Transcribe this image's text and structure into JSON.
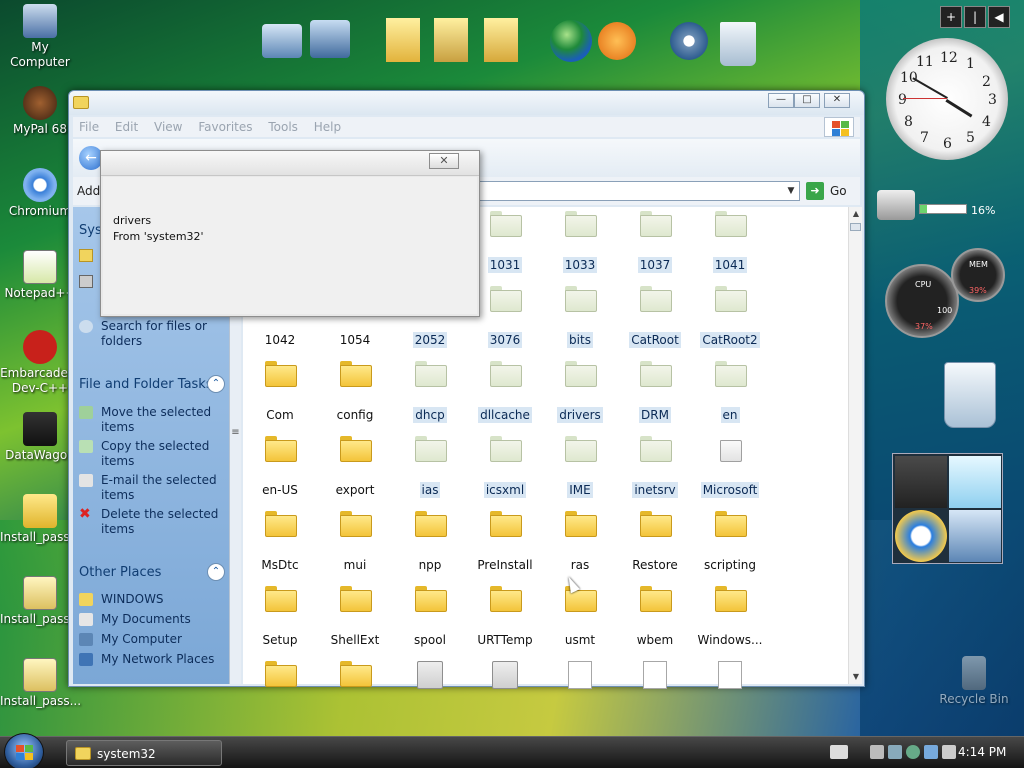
{
  "desktop": {
    "icons": [
      {
        "label": "My Computer"
      },
      {
        "label": "MyPal 68"
      },
      {
        "label": "Chromium"
      },
      {
        "label": "Notepad++"
      },
      {
        "label": "Embarcadero Dev-C++"
      },
      {
        "label": "DataWagon"
      },
      {
        "label": "Install_pass..."
      },
      {
        "label": "Install_pass..."
      },
      {
        "label": "Install_pass..."
      },
      {
        "label": "Recycle Bin"
      }
    ]
  },
  "dock": {
    "icons": [
      "computer-icon",
      "network-computer-icon",
      "folder-icon",
      "pictures-folder-icon",
      "music-folder-icon",
      "globe-icon",
      "media-player-icon",
      "settings-gear-icon",
      "recycle-bin-icon"
    ]
  },
  "window": {
    "menu": [
      "File",
      "Edit",
      "View",
      "Favorites",
      "Tools",
      "Help"
    ],
    "address_label": "Addr",
    "go_label": "Go",
    "pane": {
      "system_tasks_header": "Syst",
      "search_link": "Search for files or folders",
      "file_tasks_header": "File and Folder Tasks",
      "file_tasks": [
        "Move the selected items",
        "Copy the selected items",
        "E-mail the selected items",
        "Delete the selected items"
      ],
      "other_places_header": "Other Places",
      "other_places": [
        "WINDOWS",
        "My Documents",
        "My Computer",
        "My Network Places"
      ]
    },
    "items": [
      {
        "name": "1031",
        "kind": "ghost",
        "selected": true
      },
      {
        "name": "1033",
        "kind": "ghost",
        "selected": true
      },
      {
        "name": "1037",
        "kind": "ghost",
        "selected": true
      },
      {
        "name": "1041",
        "kind": "ghost",
        "selected": true
      },
      {
        "name": "1042",
        "kind": "folder",
        "selected": false
      },
      {
        "name": "1054",
        "kind": "folder",
        "selected": false
      },
      {
        "name": "2052",
        "kind": "ghost",
        "selected": true
      },
      {
        "name": "3076",
        "kind": "ghost",
        "selected": true
      },
      {
        "name": "bits",
        "kind": "ghost",
        "selected": true
      },
      {
        "name": "CatRoot",
        "kind": "ghost",
        "selected": true
      },
      {
        "name": "CatRoot2",
        "kind": "ghost",
        "selected": true
      },
      {
        "name": "Com",
        "kind": "folder",
        "selected": false
      },
      {
        "name": "config",
        "kind": "folder",
        "selected": false
      },
      {
        "name": "dhcp",
        "kind": "ghost",
        "selected": true
      },
      {
        "name": "dllcache",
        "kind": "ghost",
        "selected": true
      },
      {
        "name": "drivers",
        "kind": "ghost",
        "selected": true
      },
      {
        "name": "DRM",
        "kind": "ghost",
        "selected": true
      },
      {
        "name": "en",
        "kind": "ghost",
        "selected": true
      },
      {
        "name": "en-US",
        "kind": "folder",
        "selected": false
      },
      {
        "name": "export",
        "kind": "folder",
        "selected": false
      },
      {
        "name": "ias",
        "kind": "ghost",
        "selected": true
      },
      {
        "name": "icsxml",
        "kind": "ghost",
        "selected": true
      },
      {
        "name": "IME",
        "kind": "ghost",
        "selected": true
      },
      {
        "name": "inetsrv",
        "kind": "ghost",
        "selected": true
      },
      {
        "name": "Microsoft",
        "kind": "white",
        "selected": true
      },
      {
        "name": "MsDtc",
        "kind": "folder",
        "selected": false
      },
      {
        "name": "mui",
        "kind": "folder",
        "selected": false
      },
      {
        "name": "npp",
        "kind": "folder",
        "selected": false
      },
      {
        "name": "PreInstall",
        "kind": "folder",
        "selected": false
      },
      {
        "name": "ras",
        "kind": "folder",
        "selected": false
      },
      {
        "name": "Restore",
        "kind": "folder",
        "selected": false
      },
      {
        "name": "scripting",
        "kind": "folder",
        "selected": false
      },
      {
        "name": "Setup",
        "kind": "folder",
        "selected": false
      },
      {
        "name": "ShellExt",
        "kind": "folder",
        "selected": false
      },
      {
        "name": "spool",
        "kind": "folder",
        "selected": false
      },
      {
        "name": "URTTemp",
        "kind": "folder",
        "selected": false
      },
      {
        "name": "usmt",
        "kind": "folder",
        "selected": false
      },
      {
        "name": "wbem",
        "kind": "folder",
        "selected": false
      },
      {
        "name": "Windows...",
        "kind": "folder",
        "selected": false
      },
      {
        "name": "",
        "kind": "folder",
        "selected": false
      },
      {
        "name": "",
        "kind": "folder",
        "selected": false
      },
      {
        "name": "",
        "kind": "gear",
        "selected": false
      },
      {
        "name": "",
        "kind": "gear",
        "selected": false
      },
      {
        "name": "",
        "kind": "file",
        "selected": false
      },
      {
        "name": "",
        "kind": "file",
        "selected": false
      },
      {
        "name": "",
        "kind": "file",
        "selected": false
      }
    ]
  },
  "tooltip": {
    "line1": "drivers",
    "line2": "From 'system32'"
  },
  "gadgets": {
    "clock": {
      "numbers": [
        "12",
        "1",
        "2",
        "3",
        "4",
        "5",
        "6",
        "7",
        "8",
        "9",
        "10",
        "11"
      ]
    },
    "disk_meter_pct": "16%",
    "disk_fill": 0.16,
    "cpu_label": "CPU",
    "mem_label": "MEM",
    "cpu_pct": "37%",
    "mem_pct": "39%",
    "cpu_max": "100"
  },
  "taskbar": {
    "task_label": "system32",
    "time": "4:14 PM"
  }
}
